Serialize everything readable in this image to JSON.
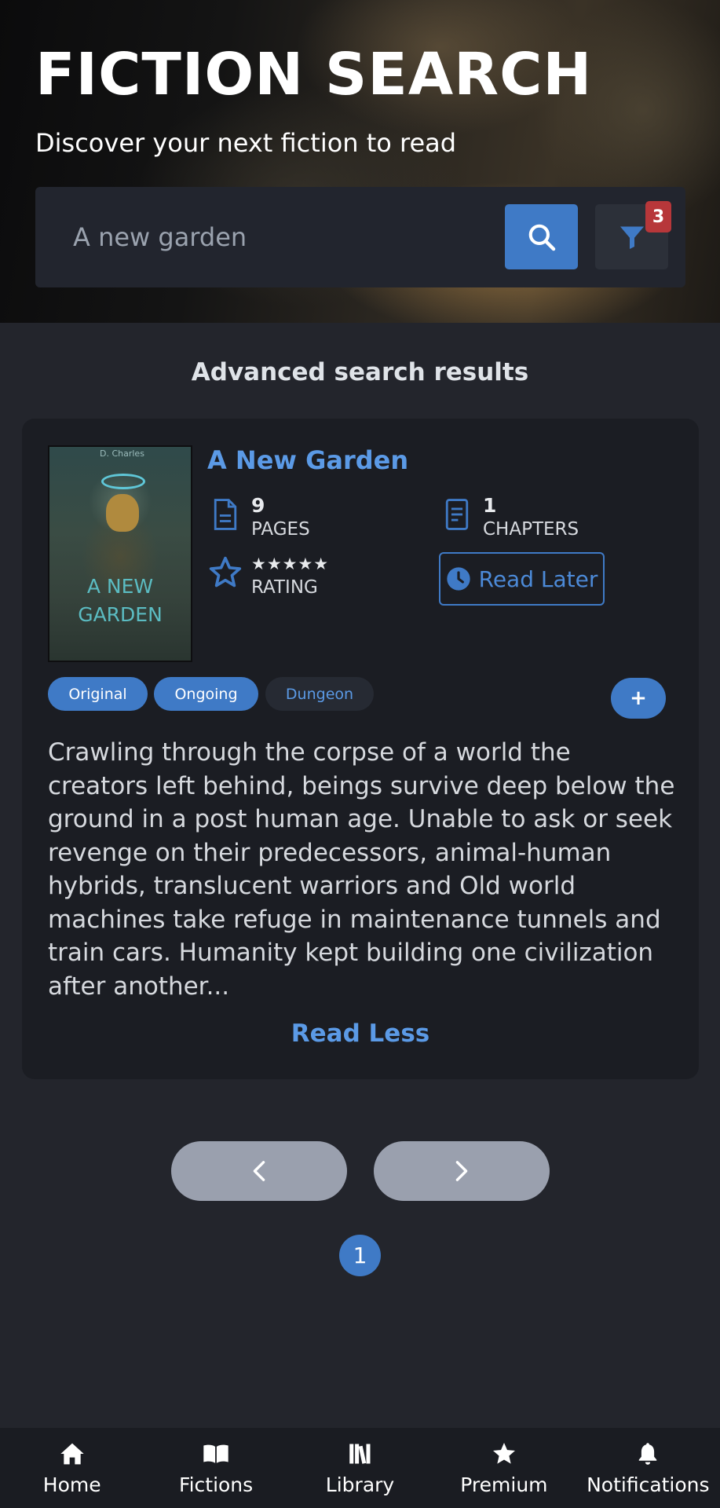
{
  "header": {
    "title": "FICTION SEARCH",
    "subtitle": "Discover your next fiction to read"
  },
  "search": {
    "placeholder": "A new garden",
    "filter_count": "3"
  },
  "results": {
    "heading": "Advanced search results"
  },
  "book": {
    "title": "A New Garden",
    "cover": {
      "author": "D. Charles",
      "title_lines": "A NEW GARDEN"
    },
    "pages_value": "9",
    "pages_label": "PAGES",
    "chapters_value": "1",
    "chapters_label": "CHAPTERS",
    "rating_stars": "★★★★★",
    "rating_label": "RATING",
    "read_later_label": "Read Later",
    "tags": [
      "Original",
      "Ongoing",
      "Dungeon"
    ],
    "add_label": "+",
    "description": "Crawling through the corpse of a world the creators left behind, beings survive deep below the ground in a post human age. Unable to ask or seek revenge on their predecessors, animal-human hybrids, translucent warriors and Old world machines take refuge in maintenance tunnels and train cars. Humanity kept building one civilization after another...",
    "read_less_label": "Read Less"
  },
  "pagination": {
    "current_page": "1"
  },
  "nav": {
    "items": [
      {
        "label": "Home",
        "icon": "home-icon"
      },
      {
        "label": "Fictions",
        "icon": "book-open-icon"
      },
      {
        "label": "Library",
        "icon": "library-icon"
      },
      {
        "label": "Premium",
        "icon": "star-icon"
      },
      {
        "label": "Notifications",
        "icon": "bell-icon"
      }
    ]
  },
  "colors": {
    "accent": "#3f7ac6",
    "link": "#5b9ae6",
    "badge": "#b7373a",
    "background": "#23252c",
    "card": "#1b1d23"
  }
}
